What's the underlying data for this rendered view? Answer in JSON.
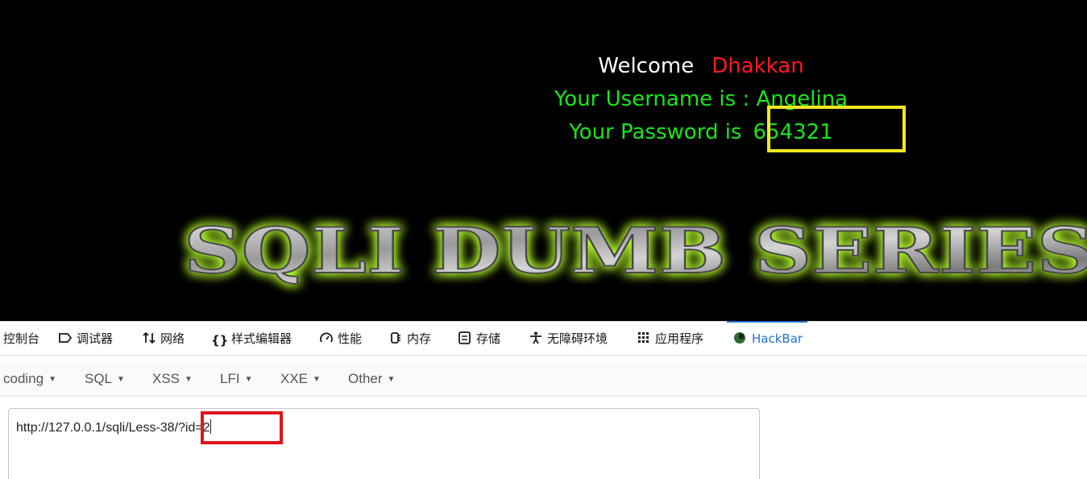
{
  "page": {
    "welcome_label": "Welcome",
    "welcome_name": "Dhakkan",
    "username_line": "Your Username is : Angelina",
    "password_label": "Your Password is",
    "password_value": "654321",
    "banner_text": "SQLI DUMB SERIES"
  },
  "devtools": {
    "tabs": [
      {
        "label": "控制台",
        "icon": "console-icon"
      },
      {
        "label": "调试器",
        "icon": "debugger-icon"
      },
      {
        "label": "网络",
        "icon": "network-arrows-icon"
      },
      {
        "label": "样式编辑器",
        "icon": "braces-icon"
      },
      {
        "label": "性能",
        "icon": "gauge-icon"
      },
      {
        "label": "内存",
        "icon": "memory-chip-icon"
      },
      {
        "label": "存储",
        "icon": "storage-icon"
      },
      {
        "label": "无障碍环境",
        "icon": "accessibility-icon"
      },
      {
        "label": "应用程序",
        "icon": "grid-apps-icon"
      },
      {
        "label": "HackBar",
        "icon": "hackbar-logo-icon",
        "active": true
      }
    ]
  },
  "hackbar": {
    "menu": [
      "coding",
      "SQL",
      "XSS",
      "LFI",
      "XXE",
      "Other"
    ],
    "url_value": "http://127.0.0.1/sqli/Less-38/?id=2"
  },
  "colors": {
    "background": "#000000",
    "welcome_name": "#ff1a1a",
    "green_text": "#19e619",
    "highlight_yellow": "#f2e81f",
    "highlight_red": "#e0141e",
    "active_tab": "#1f6fd6",
    "banner_glow": "#b8ff2e"
  }
}
